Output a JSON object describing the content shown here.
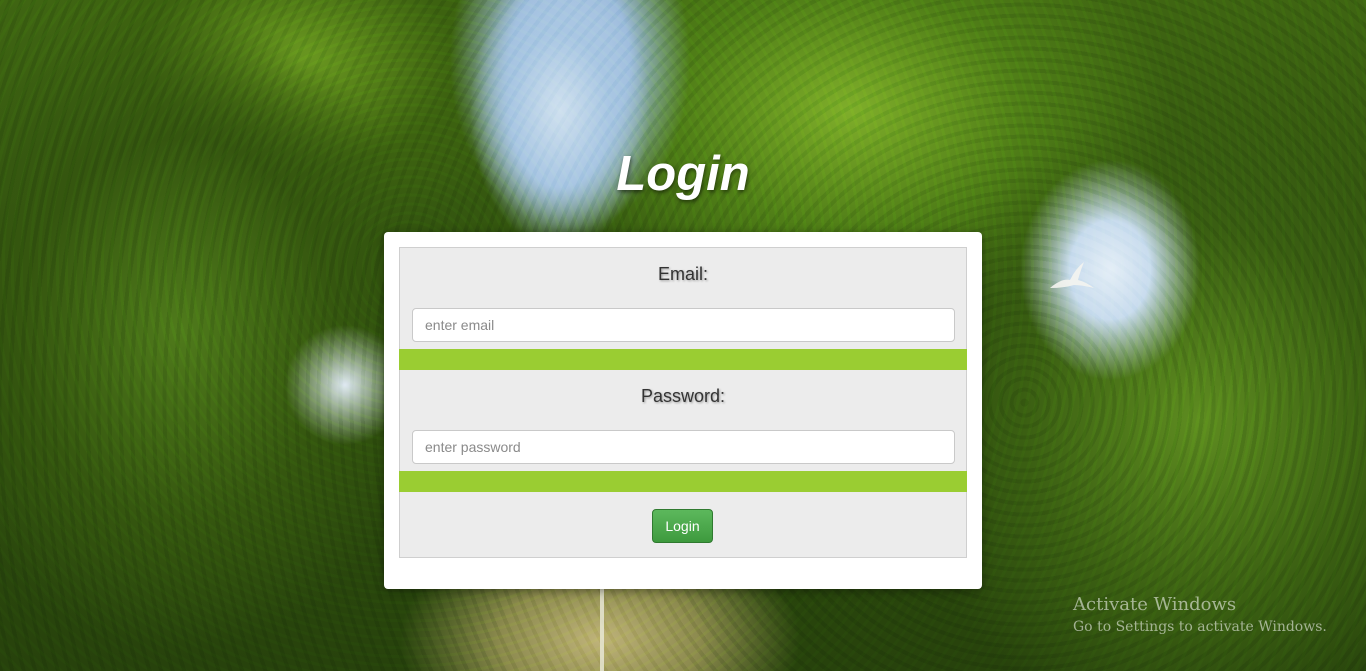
{
  "page": {
    "title": "Login"
  },
  "form": {
    "email": {
      "label": "Email:",
      "placeholder": "enter email",
      "value": ""
    },
    "password": {
      "label": "Password:",
      "placeholder": "enter password",
      "value": ""
    },
    "submit_label": "Login"
  },
  "colors": {
    "accent_bar": "#9acd32",
    "button": "#4cae4c",
    "panel": "#ececec"
  },
  "watermark": {
    "title": "Activate Windows",
    "subtitle": "Go to Settings to activate Windows."
  }
}
